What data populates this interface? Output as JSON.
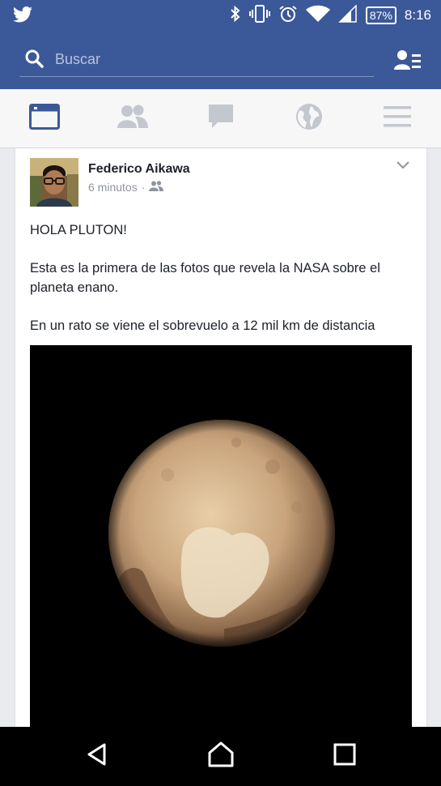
{
  "status_bar": {
    "battery": "87%",
    "time": "8:16"
  },
  "search": {
    "placeholder": "Buscar"
  },
  "post": {
    "author": "Federico Aikawa",
    "time": "6 minutos",
    "separator": "·",
    "paragraphs": [
      "HOLA PLUTON!",
      "Esta es la primera de las fotos que revela la NASA sobre el planeta enano.",
      "En un rato se viene el sobrevuelo a 12 mil km de distancia"
    ]
  },
  "colors": {
    "brand": "#3b5998",
    "active_tab": "#3b5998",
    "inactive_tab": "#c3c7ce",
    "photo_bg": "#000000"
  },
  "icons": {
    "status": [
      "twitter-icon",
      "bluetooth-icon",
      "vibrate-icon",
      "alarm-icon",
      "wifi-icon",
      "signal-icon",
      "battery-icon"
    ],
    "tabs": [
      "news-feed-icon",
      "friend-requests-icon",
      "messages-icon",
      "notifications-globe-icon",
      "more-menu-icon"
    ],
    "nav": [
      "back-icon",
      "home-icon",
      "recents-icon"
    ]
  }
}
